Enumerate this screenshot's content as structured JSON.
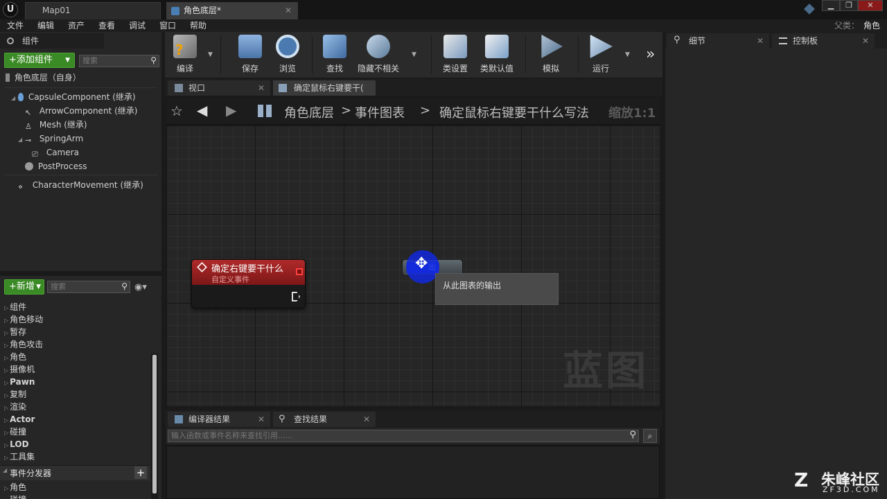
{
  "titlebar": {
    "logo": "U",
    "tabs": [
      {
        "label": "Map01"
      },
      {
        "label": "角色底层*"
      }
    ],
    "right_label": "父类：",
    "right_value": "角色",
    "window_buttons": [
      "▁",
      "❐",
      "✕"
    ]
  },
  "menu": [
    "文件",
    "编辑",
    "资产",
    "查看",
    "调试",
    "窗口",
    "帮助"
  ],
  "components": {
    "tab": "组件",
    "add_button": "+添加组件",
    "search_placeholder": "搜索",
    "root": "角色底层（自身）",
    "items": [
      {
        "label": "CapsuleComponent (继承)"
      },
      {
        "label": "ArrowComponent (继承)"
      },
      {
        "label": "Mesh (继承)"
      },
      {
        "label": "SpringArm"
      },
      {
        "label": "Camera"
      },
      {
        "label": "PostProcess"
      },
      {
        "label": "CharacterMovement (继承)"
      }
    ]
  },
  "my_blueprint": {
    "new_button": "+新增",
    "search_placeholder": "搜索",
    "categories": [
      "组件",
      "角色移动",
      "暂存",
      "角色攻击",
      "角色",
      "摄像机",
      "Pawn",
      "复制",
      "渲染",
      "Actor",
      "碰撞",
      "LOD",
      "工具集"
    ],
    "dispatcher": "事件分发器",
    "dispatcher_items": [
      "角色",
      "碰撞"
    ]
  },
  "toolbar": {
    "items": [
      {
        "label": "编译",
        "icon": "compile-icon"
      },
      {
        "label": "保存",
        "icon": "save-icon"
      },
      {
        "label": "浏览",
        "icon": "browse-icon"
      },
      {
        "label": "查找",
        "icon": "find-icon"
      },
      {
        "label": "隐藏不相关",
        "icon": "hide-unrelated-icon"
      },
      {
        "label": "类设置",
        "icon": "class-settings-icon"
      },
      {
        "label": "类默认值",
        "icon": "class-defaults-icon"
      },
      {
        "label": "模拟",
        "icon": "simulate-icon"
      },
      {
        "label": "运行",
        "icon": "play-icon"
      }
    ],
    "more": "»"
  },
  "graph_tabs": [
    {
      "label": "视口"
    },
    {
      "label": "确定鼠标右键要干("
    }
  ],
  "breadcrumb": {
    "segments": [
      "角色底层",
      "事件图表",
      "确定鼠标右键要干什么写法"
    ],
    "zoom": "缩放1:1"
  },
  "graph": {
    "watermark": "蓝图",
    "event_node": {
      "title": "确定右键要干什么",
      "subtitle": "自定义事件"
    },
    "reroute_label": "出",
    "tooltip": "从此图表的输出"
  },
  "bottom": {
    "tabs": [
      {
        "label": "编译器结果"
      },
      {
        "label": "查找结果"
      }
    ],
    "search_placeholder": "输入函数或事件名称来查找引用......"
  },
  "right": {
    "tabs": [
      {
        "label": "细节"
      },
      {
        "label": "控制板"
      }
    ]
  },
  "site_watermark": {
    "logo": "Z",
    "name": "朱峰社区",
    "url": "ZF3D.COM"
  },
  "colors": {
    "accent_green": "#3a8a25",
    "event_red": "#b02a2a",
    "highlight_blue": "#1a2fd6"
  }
}
